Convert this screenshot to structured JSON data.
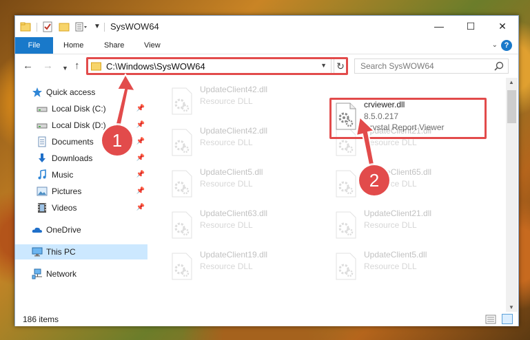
{
  "window": {
    "title": "SysWOW64",
    "minimize_glyph": "—",
    "maximize_glyph": "☐",
    "close_glyph": "✕"
  },
  "ribbon": {
    "tabs": [
      "File",
      "Home",
      "Share",
      "View"
    ],
    "help_glyph": "?"
  },
  "address": {
    "path": "C:\\Windows\\SysWOW64",
    "search_placeholder": "Search SysWOW64"
  },
  "nav_pane": {
    "items": [
      {
        "label": "Quick access",
        "icon": "star-icon"
      },
      {
        "label": "Local Disk (C:)",
        "icon": "drive-icon",
        "pinned": true
      },
      {
        "label": "Local Disk (D:)",
        "icon": "drive-icon",
        "pinned": true
      },
      {
        "label": "Documents",
        "icon": "documents-icon",
        "pinned": true
      },
      {
        "label": "Downloads",
        "icon": "downloads-icon",
        "pinned": true
      },
      {
        "label": "Music",
        "icon": "music-icon",
        "pinned": true
      },
      {
        "label": "Pictures",
        "icon": "pictures-icon",
        "pinned": true
      },
      {
        "label": "Videos",
        "icon": "videos-icon",
        "pinned": true
      },
      {
        "label": "OneDrive",
        "icon": "onedrive-icon"
      },
      {
        "label": "This PC",
        "icon": "computer-icon",
        "selected": true
      },
      {
        "label": "Network",
        "icon": "network-icon"
      }
    ]
  },
  "files": [
    {
      "name": "UpdateClient42.dll",
      "type": "Resource DLL"
    },
    {
      "name": "crviewer.dll",
      "type": "8.5.0.217",
      "description": "Crystal Report Viewer"
    },
    {
      "name": "UpdateClient42.dll",
      "type": "Resource DLL"
    },
    {
      "name": "UpdateClient21.dll",
      "type": "Resource DLL"
    },
    {
      "name": "UpdateClient5.dll",
      "type": "Resource DLL"
    },
    {
      "name": "UpdateClient65.dll",
      "type": "Resource DLL"
    },
    {
      "name": "UpdateClient63.dll",
      "type": "Resource DLL"
    },
    {
      "name": "UpdateClient21.dll",
      "type": "Resource DLL"
    },
    {
      "name": "UpdateClient19.dll",
      "type": "Resource DLL"
    },
    {
      "name": "UpdateClient5.dll",
      "type": "Resource DLL"
    }
  ],
  "status": {
    "item_count": "186 items"
  },
  "annotations": {
    "step1": "1",
    "step2": "2",
    "color": "#e24b4b"
  }
}
